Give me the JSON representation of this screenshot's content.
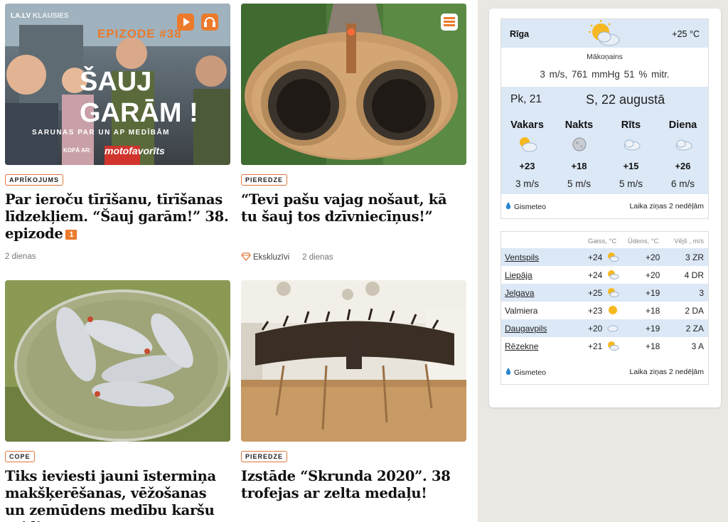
{
  "articles": [
    {
      "image_overlay": {
        "brand": "LA.LV",
        "brand_sub": "KLAUSIES",
        "episode": "EPIZODE #38",
        "title_line1": "ŠAUJ",
        "title_line2": "GARĀM !",
        "subtitle": "SARUNAS PAR UN AP MEDĪBĀM",
        "partner_prefix": "KOPĀ AR:",
        "partner": "motofavorīts"
      },
      "tag": "APRĪKOJUMS",
      "title": "Par ieroču tīrīšanu, tīrīšanas līdzekļiem. “Šauj garām!” 38. epizode",
      "badge": "1",
      "time": "2 dienas"
    },
    {
      "tag": "PIEREDZE",
      "title": "“Tevi pašu vajag nošaut, kā tu šauj tos dzīvniecīņus!”",
      "exclusive": "Ekskluzīvi",
      "time": "2 dienas"
    },
    {
      "tag": "COPE",
      "title": "Tiks ieviesti jauni īstermiņa makšķerēšanas, vēžošanas un zemūdens medību karšu veidi"
    },
    {
      "tag": "PIEREDZE",
      "title": "Izstāde “Skrunda 2020”. 38 trofejas ar zelta medaļu!"
    }
  ],
  "weather": {
    "city": "Rīga",
    "temp": "+25 °C",
    "desc": "Mākoņains",
    "stats": "3 m/s,   761 mmHg   51 % mitr.",
    "day_prev": "Pk, 21",
    "day_current": "S, 22 augustā",
    "parts": [
      {
        "name": "Vakars",
        "icon": "sun-cloud-icon",
        "temp": "+23",
        "wind": "3 m/s"
      },
      {
        "name": "Nakts",
        "icon": "moon-icon",
        "temp": "+18",
        "wind": "5 m/s"
      },
      {
        "name": "Rīts",
        "icon": "cloud-icon",
        "temp": "+15",
        "wind": "5 m/s"
      },
      {
        "name": "Diena",
        "icon": "cloud-icon",
        "temp": "+26",
        "wind": "6 m/s"
      }
    ],
    "source": "Gismeteo",
    "more": "Laika ziņas 2 nedēļām"
  },
  "cities_table": {
    "headers": {
      "air": "Gaiss, °C",
      "water": "Ūdens, °C",
      "wind": "Vējš , m/s"
    },
    "rows": [
      {
        "city": "Ventspils",
        "air": "+24",
        "icon": "sun-cloud-icon",
        "water": "+20",
        "wind": "3 ZR"
      },
      {
        "city": "Liepāja",
        "air": "+24",
        "icon": "sun-cloud-icon",
        "water": "+20",
        "wind": "4 DR"
      },
      {
        "city": "Jelgava",
        "air": "+25",
        "icon": "sun-cloud-icon",
        "water": "+19",
        "wind": "3"
      },
      {
        "city": "Valmiera",
        "air": "+23",
        "icon": "sun-icon",
        "water": "+18",
        "wind": "2 DA"
      },
      {
        "city": "Daugavpils",
        "air": "+20",
        "icon": "cloud-icon",
        "water": "+19",
        "wind": "2 ZA"
      },
      {
        "city": "Rēzekne",
        "air": "+21",
        "icon": "sun-cloud-icon",
        "water": "+18",
        "wind": "3 A"
      }
    ],
    "source": "Gismeteo",
    "more": "Laika ziņas 2 nedēļām"
  },
  "colors": {
    "accent": "#e0773a",
    "band": "#dce8f6"
  }
}
